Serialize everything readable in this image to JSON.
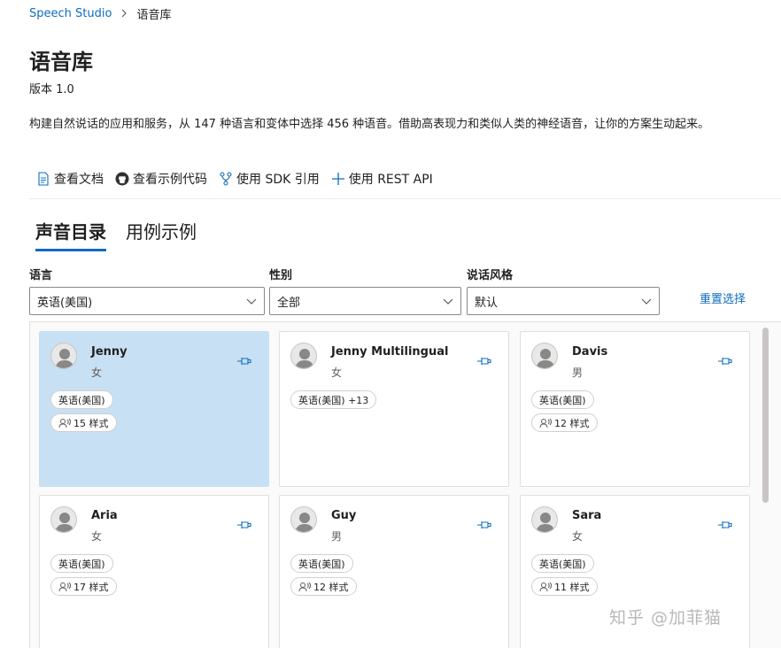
{
  "breadcrumb": {
    "root": "Speech Studio",
    "current": "语音库"
  },
  "page": {
    "title": "语音库",
    "version": "版本 1.0",
    "description": "构建自然说话的应用和服务，从 147 种语言和变体中选择 456 种语音。借助高表现力和类似人类的神经语音，让你的方案生动起来。"
  },
  "actions": [
    {
      "label": "查看文档",
      "icon": "document-icon"
    },
    {
      "label": "查看示例代码",
      "icon": "github-icon"
    },
    {
      "label": "使用 SDK 引用",
      "icon": "branch-icon"
    },
    {
      "label": "使用 REST API",
      "icon": "plus-icon"
    }
  ],
  "tabs": [
    {
      "label": "声音目录",
      "active": true
    },
    {
      "label": "用例示例",
      "active": false
    }
  ],
  "filters": {
    "language": {
      "label": "语言",
      "value": "英语(美国)"
    },
    "gender": {
      "label": "性别",
      "value": "全部"
    },
    "style": {
      "label": "说话风格",
      "value": "默认"
    },
    "reset_label": "重置选择"
  },
  "voices": [
    {
      "name": "Jenny",
      "gender": "女",
      "locale": "英语(美国)",
      "styles": "15 样式",
      "selected": true
    },
    {
      "name": "Jenny Multilingual",
      "gender": "女",
      "locale": "英语(美国) +13",
      "styles": "",
      "selected": false
    },
    {
      "name": "Davis",
      "gender": "男",
      "locale": "英语(美国)",
      "styles": "12 样式",
      "selected": false
    },
    {
      "name": "Aria",
      "gender": "女",
      "locale": "英语(美国)",
      "styles": "17 样式",
      "selected": false
    },
    {
      "name": "Guy",
      "gender": "男",
      "locale": "英语(美国)",
      "styles": "12 样式",
      "selected": false
    },
    {
      "name": "Sara",
      "gender": "女",
      "locale": "英语(美国)",
      "styles": "11 样式",
      "selected": false
    }
  ],
  "watermark": "知乎 @加菲猫",
  "colors": {
    "accent": "#0f6cbd",
    "selected_card": "#c7e0f4",
    "border": "#e1dfdd"
  }
}
